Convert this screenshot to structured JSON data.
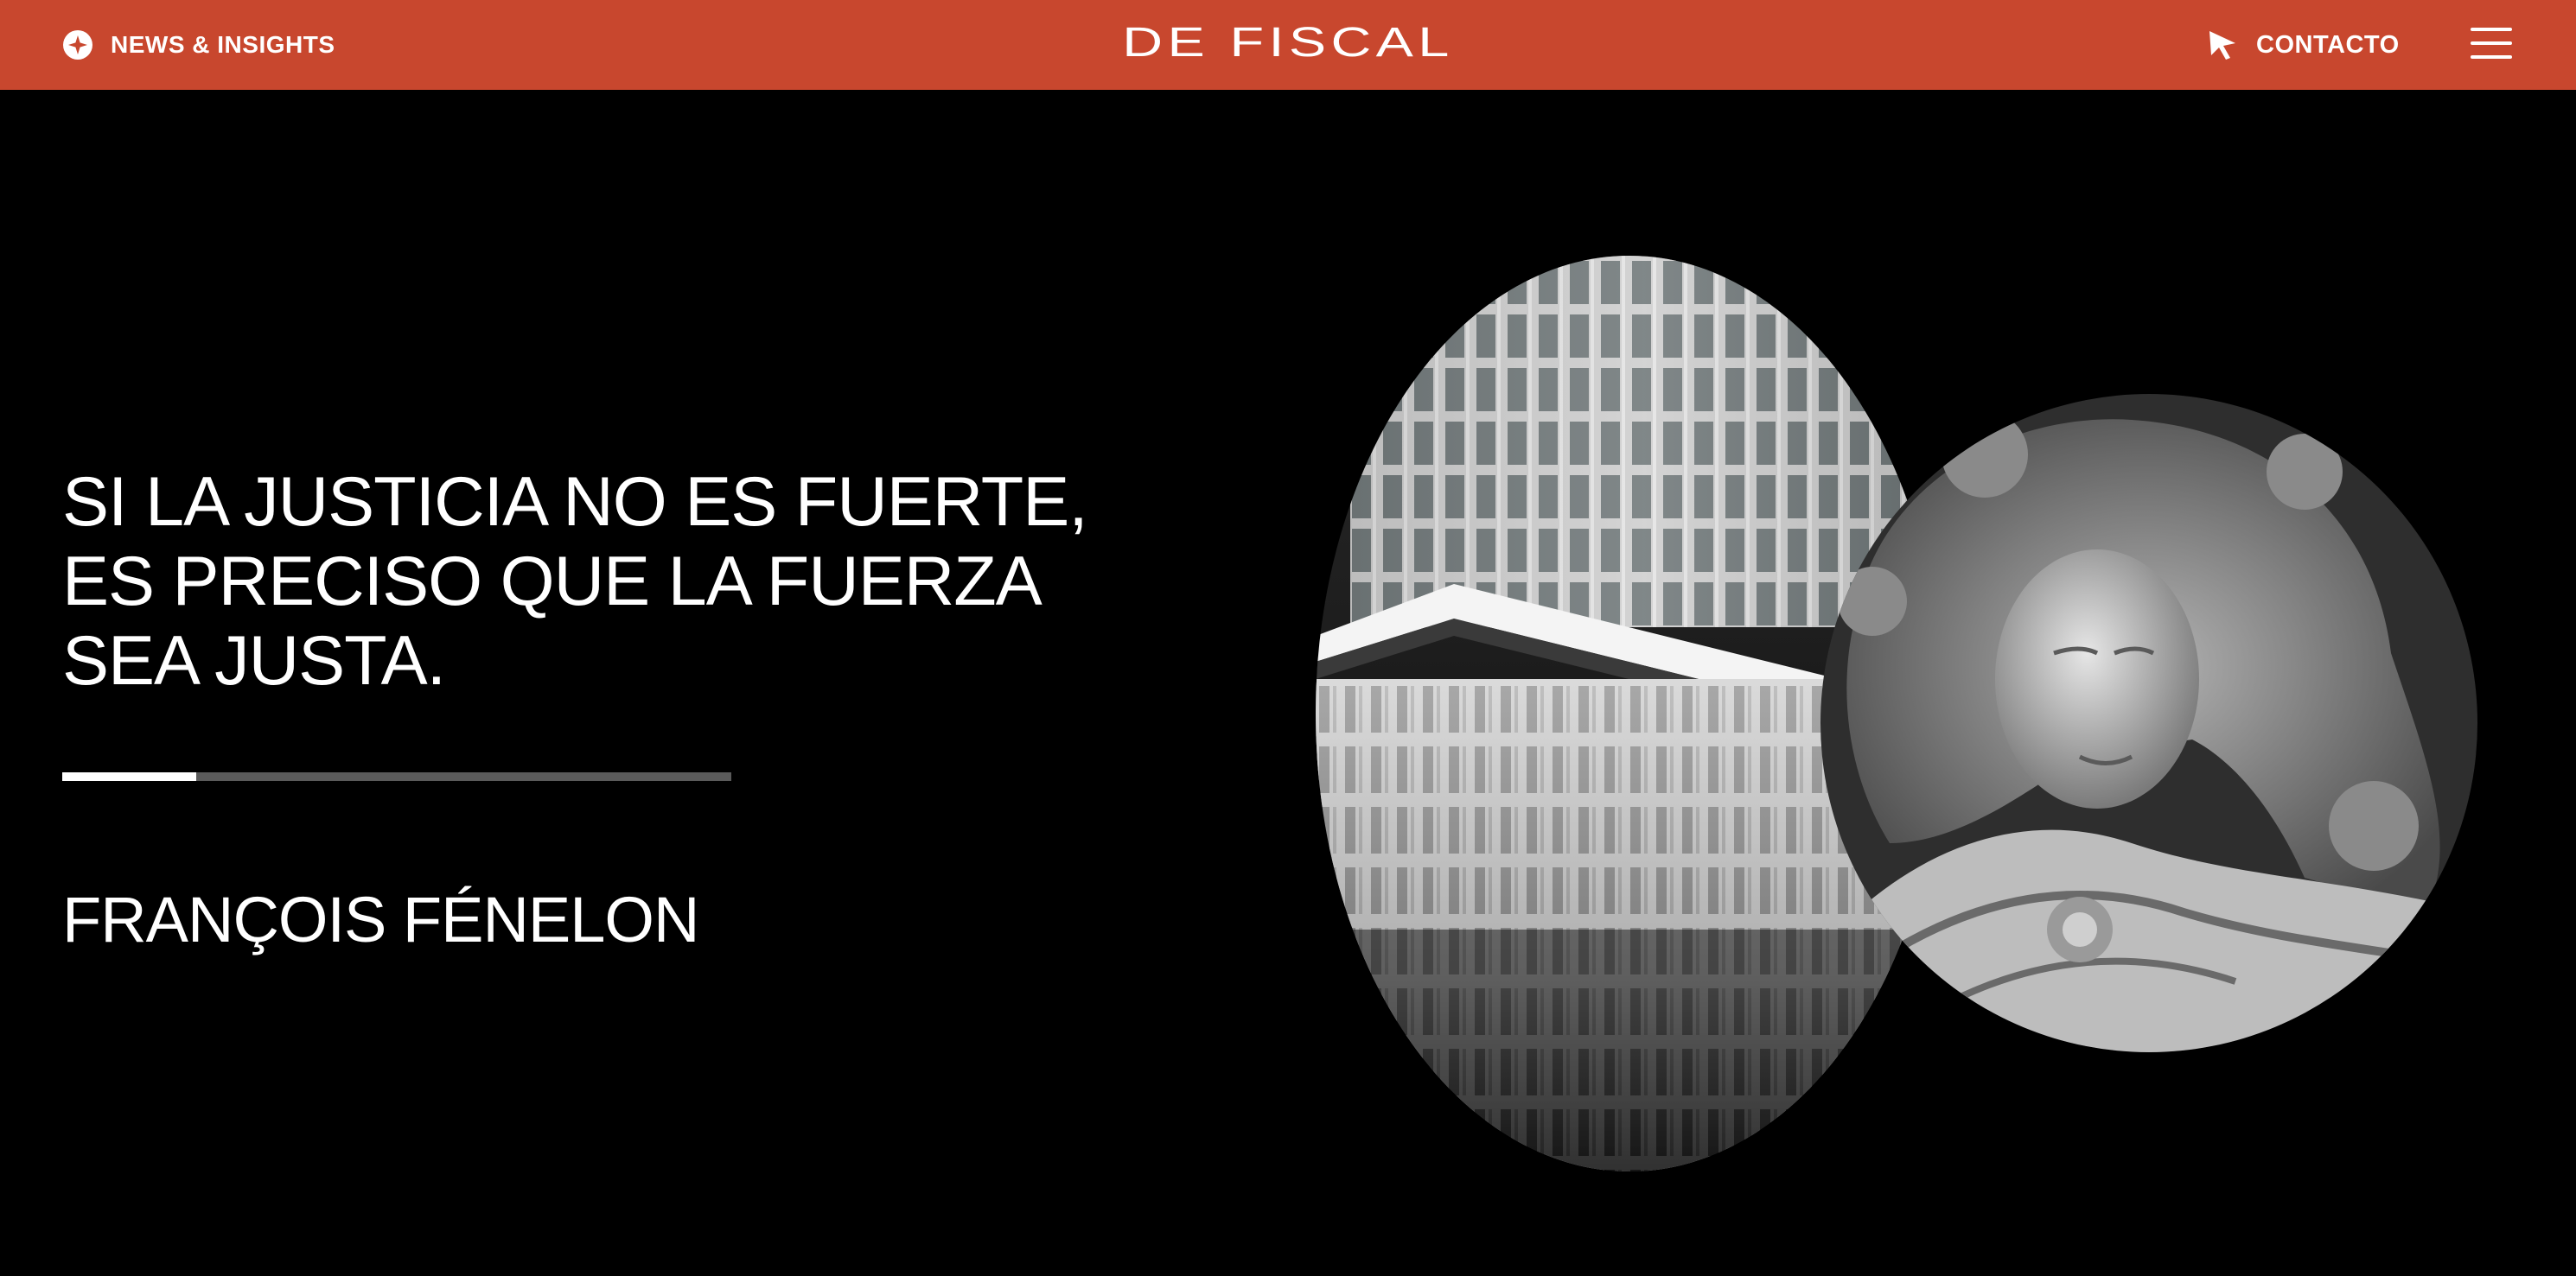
{
  "header": {
    "news_label": "NEWS & INSIGHTS",
    "logo_text": "DE FISCAL",
    "contact_label": "CONTACTO",
    "news_icon": "star-circle-icon",
    "contact_icon": "cursor-arrow-icon",
    "menu_icon": "hamburger-menu-icon",
    "background_color": "#c8472e"
  },
  "hero": {
    "quote_lines": [
      "SI LA JUSTICIA NO ES FUERTE,",
      "ES PRECISO QUE LA FUERZA",
      "SEA JUSTA."
    ],
    "author": "FRANÇOIS FÉNELON",
    "progress": 0.2
  }
}
